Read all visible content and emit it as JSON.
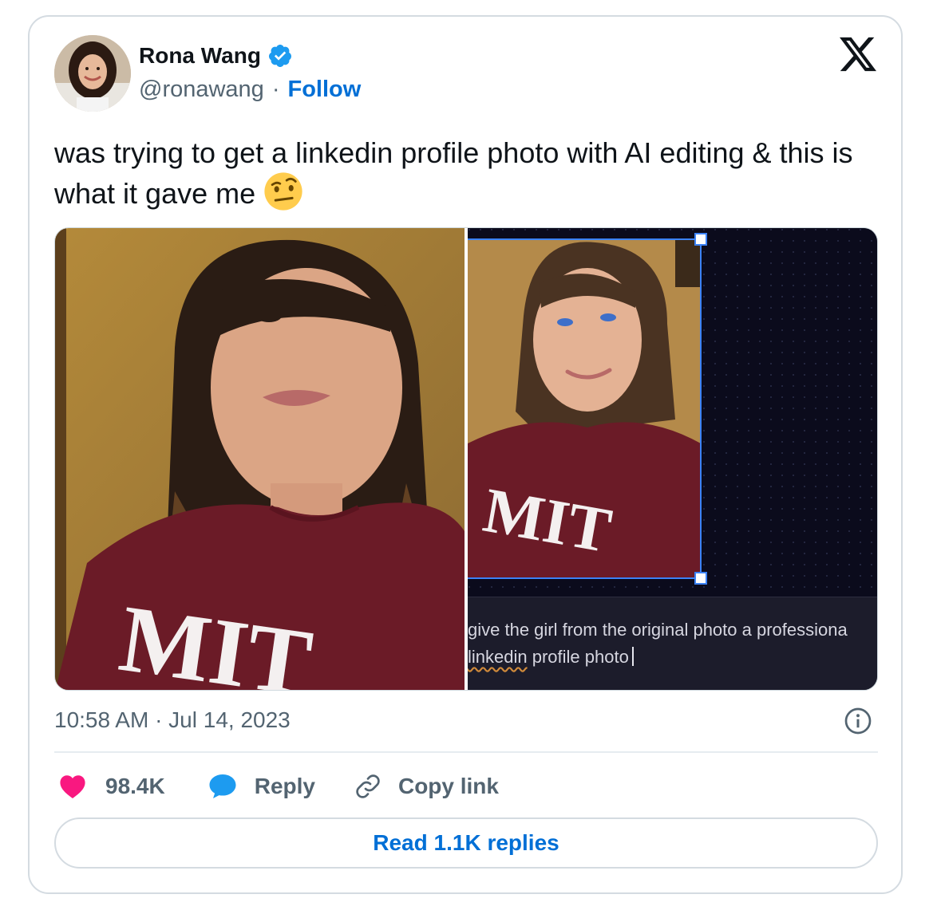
{
  "author": {
    "name": "Rona Wang",
    "handle": "@ronawang",
    "separator": "·",
    "follow_label": "Follow",
    "verified_color": "#1d9bf0"
  },
  "tweet": {
    "text": "was trying to get a linkedin profile photo with AI editing & this is what it gave me",
    "emoji": "raised-eyebrow-face"
  },
  "media": {
    "left_photo_caption": "MIT",
    "right_photo_caption": "MIT",
    "prompt": {
      "line1": "give the girl from the original photo a professiona",
      "line2_word": "linkedin",
      "line2_rest": " profile photo"
    }
  },
  "meta": {
    "timestamp": "10:58 AM · Jul 14, 2023"
  },
  "actions": {
    "likes_count": "98.4K",
    "reply_label": "Reply",
    "copy_link_label": "Copy link",
    "like_color": "#f91880",
    "reply_color": "#1d9bf0"
  },
  "footer": {
    "read_replies_label": "Read 1.1K replies"
  },
  "colors": {
    "link": "#006fd6",
    "secondary_text": "#536471",
    "border": "#d4dbe1"
  }
}
